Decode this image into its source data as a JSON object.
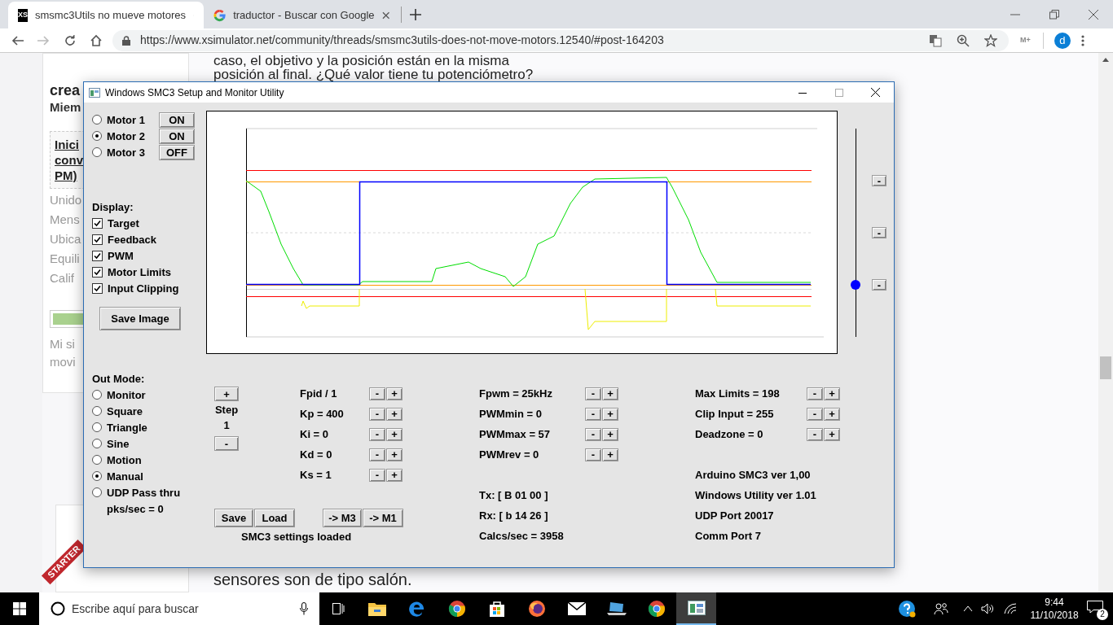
{
  "browser": {
    "tabs": [
      {
        "title": "smsmc3Utils no mueve motores",
        "icon_text": "XS",
        "selected": true
      },
      {
        "title": "traductor - Buscar con Google",
        "selected": false
      }
    ],
    "url": "https://www.xsimulator.net/community/threads/smsmc3utils-does-not-move-motors.12540/#post-164203",
    "extension_label": "M+",
    "profile_initial": "d"
  },
  "page": {
    "post_lines": [
      "caso, el objetivo y la posición están en la misma",
      "posición al final. ¿Qué valor tiene tu potenciómetro?"
    ],
    "sidebar": {
      "member_name": "crea",
      "member_title": "Miem",
      "link_lines": [
        "Inici",
        "conv",
        "PM)"
      ],
      "stats": [
        "Unido",
        "Mens",
        "Ubica",
        "Equili",
        "Calif"
      ],
      "progress": {
        "level": 1
      },
      "bio_lines": [
        "Mi si",
        "movi"
      ],
      "ribbon": "STARTER"
    },
    "footer_line": "sensores son de tipo salón."
  },
  "dialog": {
    "title": "Windows SMC3 Setup and Monitor Utility",
    "motors": [
      {
        "label": "Motor 1",
        "selected": false,
        "toggle": "ON"
      },
      {
        "label": "Motor 2",
        "selected": true,
        "toggle": "ON"
      },
      {
        "label": "Motor 3",
        "selected": false,
        "toggle": "OFF"
      }
    ],
    "display_label": "Display:",
    "display_options": [
      {
        "label": "Target",
        "checked": true
      },
      {
        "label": "Feedback",
        "checked": true
      },
      {
        "label": "PWM",
        "checked": true
      },
      {
        "label": "Motor Limits",
        "checked": true
      },
      {
        "label": "Input Clipping",
        "checked": true
      }
    ],
    "save_image": "Save Image",
    "out_mode_label": "Out Mode:",
    "out_modes": [
      {
        "label": "Monitor",
        "selected": false
      },
      {
        "label": "Square",
        "selected": false
      },
      {
        "label": "Triangle",
        "selected": false
      },
      {
        "label": "Sine",
        "selected": false
      },
      {
        "label": "Motion",
        "selected": false
      },
      {
        "label": "Manual",
        "selected": true
      },
      {
        "label": "UDP Pass thru",
        "selected": false
      }
    ],
    "packets": "pks/sec = 0",
    "slider": {
      "level": 0.25
    },
    "side_buttons": [
      "-",
      "-",
      "-"
    ],
    "step": {
      "plus": "+",
      "label": "Step",
      "value": "1",
      "minus": "-"
    },
    "pid_params": [
      {
        "label": "Fpid / 1",
        "buttons": [
          "-",
          "+"
        ]
      },
      {
        "label": "Kp = 400",
        "buttons": [
          "-",
          "+"
        ]
      },
      {
        "label": "Ki = 0",
        "buttons": [
          "-",
          "+"
        ]
      },
      {
        "label": "Kd = 0",
        "buttons": [
          "-",
          "+"
        ]
      },
      {
        "label": "Ks = 1",
        "buttons": [
          "-",
          "+"
        ]
      }
    ],
    "pwm_params": [
      {
        "label": "Fpwm = 25kHz",
        "buttons": [
          "-",
          "+"
        ]
      },
      {
        "label": "PWMmin = 0",
        "buttons": [
          "-",
          "+"
        ]
      },
      {
        "label": "PWMmax = 57",
        "buttons": [
          "-",
          "+"
        ]
      },
      {
        "label": "PWMrev = 0",
        "buttons": [
          "-",
          "+"
        ]
      }
    ],
    "limit_params": [
      {
        "label": "Max Limits = 198",
        "buttons": [
          "-",
          "+"
        ]
      },
      {
        "label": "Clip Input = 255",
        "buttons": [
          "-",
          "+"
        ]
      },
      {
        "label": "Deadzone = 0",
        "buttons": [
          "-",
          "+"
        ]
      }
    ],
    "file_buttons": [
      "Save",
      "Load"
    ],
    "copy_buttons": [
      "-> M3",
      "-> M1"
    ],
    "status_message": "SMC3 settings loaded",
    "link_status": [
      "Tx: [ B 01 00 ]",
      "Rx: [ b 14 26 ]",
      "Calcs/sec = 3958"
    ],
    "versions": [
      "Arduino SMC3 ver 1,00",
      "Windows Utility ver 1.01",
      "UDP Port 20017",
      "Comm Port 7"
    ]
  },
  "taskbar": {
    "search_placeholder": "Escribe aquí para buscar",
    "apps": [
      {
        "kind": "folder",
        "active": false
      },
      {
        "kind": "edge",
        "active": false
      },
      {
        "kind": "chrome",
        "active": false
      },
      {
        "kind": "store",
        "active": false
      },
      {
        "kind": "firefox",
        "active": false
      },
      {
        "kind": "mail",
        "active": false
      },
      {
        "kind": "laptop",
        "active": false
      },
      {
        "kind": "chrome",
        "active": false
      },
      {
        "kind": "monitor",
        "active": true
      }
    ],
    "time": "9:44",
    "date": "11/10/2018",
    "notifications": "2"
  }
}
